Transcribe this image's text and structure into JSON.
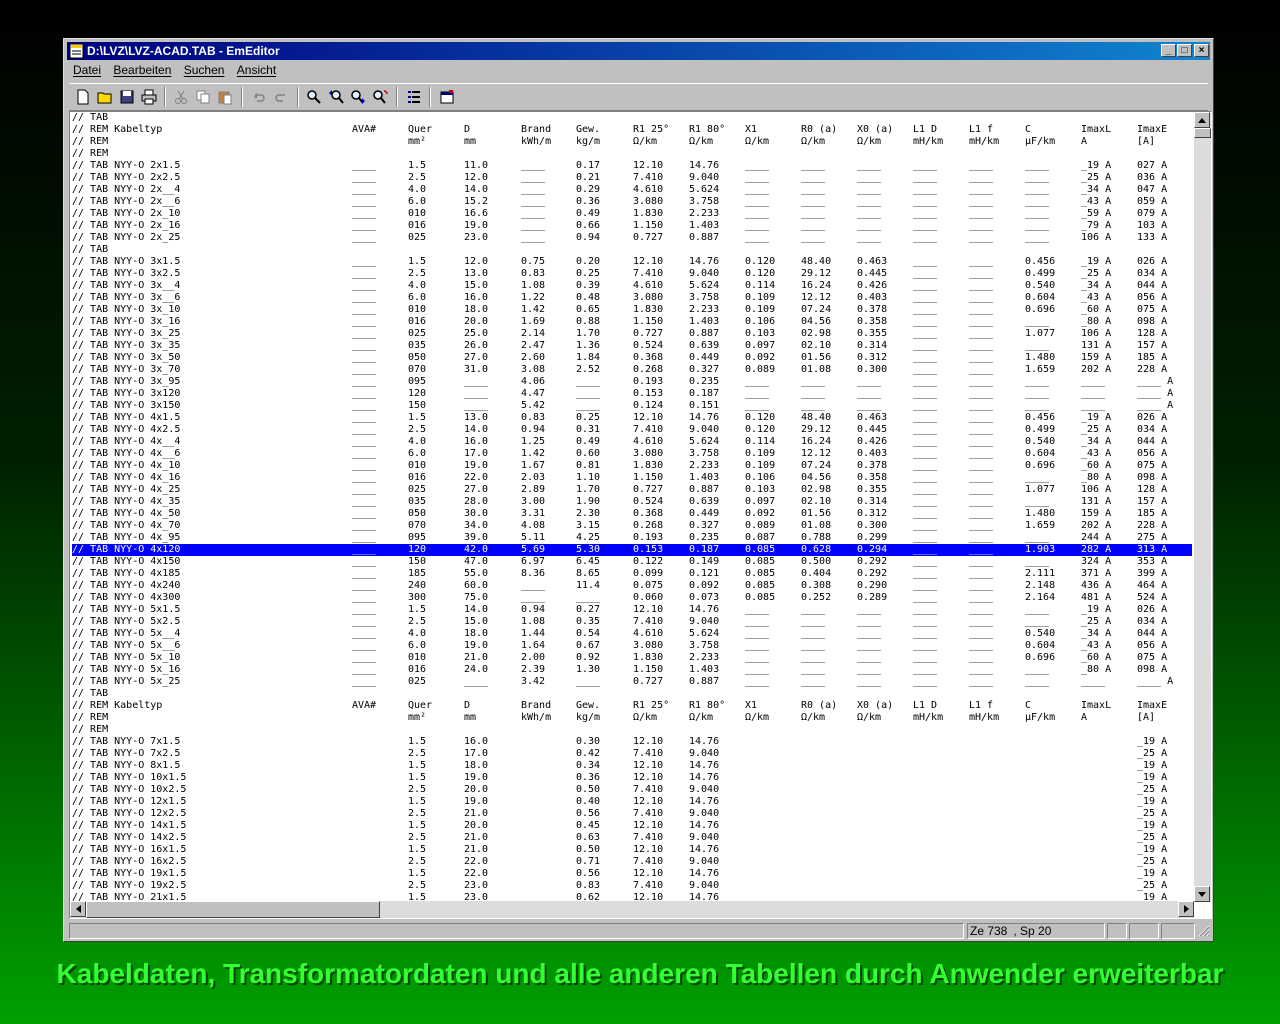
{
  "window": {
    "title": "D:\\LVZ\\LVZ-ACAD.TAB - EmEditor",
    "min_label": "_",
    "max_label": "□",
    "close_label": "×"
  },
  "menu": [
    {
      "label": "Datei"
    },
    {
      "label": "Bearbeiten"
    },
    {
      "label": "Suchen"
    },
    {
      "label": "Ansicht"
    }
  ],
  "toolbar": [
    {
      "name": "new-file-icon"
    },
    {
      "name": "open-folder-icon"
    },
    {
      "name": "save-icon"
    },
    {
      "name": "print-icon"
    },
    {
      "name": "cut-icon"
    },
    {
      "name": "copy-icon"
    },
    {
      "name": "paste-icon"
    },
    {
      "name": "undo-icon"
    },
    {
      "name": "redo-icon"
    },
    {
      "name": "find-icon"
    },
    {
      "name": "find-previous-icon"
    },
    {
      "name": "find-next-icon"
    },
    {
      "name": "replace-icon"
    },
    {
      "name": "properties-icon"
    },
    {
      "name": "window-icon"
    }
  ],
  "editor": {
    "lines": [
      "// TAB",
      "// REM Kabeltyp|AVA#|Quer|D|Brand|Gew.|R1 25°|R1 80°|X1|R0 (a)|X0 (a)|L1 D|L1 f|C|ImaxL|ImaxE",
      "// REM||mm²|mm|kWh/m|kg/m|Ω/km|Ω/km|Ω/km|Ω/km|Ω/km|mH/km|mH/km|µF/km|A|[A]",
      "// REM",
      "// TAB NYY-O 2x1.5|____|1.5|11.0|____|0.17|12.10|14.76|____|____|____|____|____|____|_19 A|027 A",
      "// TAB NYY-O 2x2.5|____|2.5|12.0|____|0.21|7.410|9.040|____|____|____|____|____|____|_25 A|036 A",
      "// TAB NYY-O 2x__4|____|4.0|14.0|____|0.29|4.610|5.624|____|____|____|____|____|____|_34 A|047 A",
      "// TAB NYY-O 2x__6|____|6.0|15.2|____|0.36|3.080|3.758|____|____|____|____|____|____|_43 A|059 A",
      "// TAB NYY-O 2x_10|____|010|16.6|____|0.49|1.830|2.233|____|____|____|____|____|____|_59 A|079 A",
      "// TAB NYY-O 2x_16|____|016|19.0|____|0.66|1.150|1.403|____|____|____|____|____|____|_79 A|103 A",
      "// TAB NYY-O 2x_25|____|025|23.0|____|0.94|0.727|0.887|____|____|____|____|____|____|106 A|133 A",
      "// TAB",
      "// TAB NYY-O 3x1.5|____|1.5|12.0|0.75|0.20|12.10|14.76|0.120|48.40|0.463|____|____|0.456|_19 A|026 A",
      "// TAB NYY-O 3x2.5|____|2.5|13.0|0.83|0.25|7.410|9.040|0.120|29.12|0.445|____|____|0.499|_25 A|034 A",
      "// TAB NYY-O 3x__4|____|4.0|15.0|1.08|0.39|4.610|5.624|0.114|16.24|0.426|____|____|0.540|_34 A|044 A",
      "// TAB NYY-O 3x__6|____|6.0|16.0|1.22|0.48|3.080|3.758|0.109|12.12|0.403|____|____|0.604|_43 A|056 A",
      "// TAB NYY-O 3x_10|____|010|18.0|1.42|0.65|1.830|2.233|0.109|07.24|0.378|____|____|0.696|_60 A|075 A",
      "// TAB NYY-O 3x_16|____|016|20.0|1.69|0.88|1.150|1.403|0.106|04.56|0.358|____|____|____|_80 A|098 A",
      "// TAB NYY-O 3x_25|____|025|25.0|2.14|1.70|0.727|0.887|0.103|02.98|0.355|____|____|1.077|106 A|128 A",
      "// TAB NYY-O 3x_35|____|035|26.0|2.47|1.36|0.524|0.639|0.097|02.10|0.314|____|____|____|131 A|157 A",
      "// TAB NYY-O 3x_50|____|050|27.0|2.60|1.84|0.368|0.449|0.092|01.56|0.312|____|____|1.480|159 A|185 A",
      "// TAB NYY-O 3x_70|____|070|31.0|3.08|2.52|0.268|0.327|0.089|01.08|0.300|____|____|1.659|202 A|228 A",
      "// TAB NYY-O 3x_95|____|095|____|4.06|____|0.193|0.235|____|____|____|____|____|____|____|____ A",
      "// TAB NYY-O 3x120|____|120|____|4.47|____|0.153|0.187|____|____|____|____|____|____|____|____ A",
      "// TAB NYY-O 3x150|____|150|____|5.42|____|0.124|0.151|____|____|____|____|____|____|____|____ A",
      "// TAB NYY-O 4x1.5|____|1.5|13.0|0.83|0.25|12.10|14.76|0.120|48.40|0.463|____|____|0.456|_19 A|026 A",
      "// TAB NYY-O 4x2.5|____|2.5|14.0|0.94|0.31|7.410|9.040|0.120|29.12|0.445|____|____|0.499|_25 A|034 A",
      "// TAB NYY-O 4x__4|____|4.0|16.0|1.25|0.49|4.610|5.624|0.114|16.24|0.426|____|____|0.540|_34 A|044 A",
      "// TAB NYY-O 4x__6|____|6.0|17.0|1.42|0.60|3.080|3.758|0.109|12.12|0.403|____|____|0.604|_43 A|056 A",
      "// TAB NYY-O 4x_10|____|010|19.0|1.67|0.81|1.830|2.233|0.109|07.24|0.378|____|____|0.696|_60 A|075 A",
      "// TAB NYY-O 4x_16|____|016|22.0|2.03|1.10|1.150|1.403|0.106|04.56|0.358|____|____|____|_80 A|098 A",
      "// TAB NYY-O 4x_25|____|025|27.0|2.89|1.70|0.727|0.887|0.103|02.98|0.355|____|____|1.077|106 A|128 A",
      "// TAB NYY-O 4x_35|____|035|28.0|3.00|1.90|0.524|0.639|0.097|02.10|0.314|____|____|____|131 A|157 A",
      "// TAB NYY-O 4x_50|____|050|30.0|3.31|2.30|0.368|0.449|0.092|01.56|0.312|____|____|1.480|159 A|185 A",
      "// TAB NYY-O 4x_70|____|070|34.0|4.08|3.15|0.268|0.327|0.089|01.08|0.300|____|____|1.659|202 A|228 A",
      "// TAB NYY-O 4x_95|____|095|39.0|5.11|4.25|0.193|0.235|0.087|0.788|0.299|____|____|____|244 A|275 A",
      "// TAB NYY-O 4x120|____|120|42.0|5.69|5.30|0.153|0.187|0.085|0.628|0.294|____|____|1.903|282 A|313 A",
      "// TAB NYY-O 4x150|____|150|47.0|6.97|6.45|0.122|0.149|0.085|0.500|0.292|____|____|____|324 A|353 A",
      "// TAB NYY-O 4x185|____|185|55.0|8.36|8.65|0.099|0.121|0.085|0.404|0.292|____|____|2.111|371 A|399 A",
      "// TAB NYY-O 4x240|____|240|60.0|____|11.4|0.075|0.092|0.085|0.308|0.290|____|____|2.148|436 A|464 A",
      "// TAB NYY-O 4x300|____|300|75.0|____|____|0.060|0.073|0.085|0.252|0.289|____|____|2.164|481 A|524 A",
      "// TAB NYY-O 5x1.5|____|1.5|14.0|0.94|0.27|12.10|14.76|____|____|____|____|____|____|_19 A|026 A",
      "// TAB NYY-O 5x2.5|____|2.5|15.0|1.08|0.35|7.410|9.040|____|____|____|____|____|____|_25 A|034 A",
      "// TAB NYY-O 5x__4|____|4.0|18.0|1.44|0.54|4.610|5.624|____|____|____|____|____|0.540|_34 A|044 A",
      "// TAB NYY-O 5x__6|____|6.0|19.0|1.64|0.67|3.080|3.758|____|____|____|____|____|0.604|_43 A|056 A",
      "// TAB NYY-O 5x_10|____|010|21.0|2.00|0.92|1.830|2.233|____|____|____|____|____|0.696|_60 A|075 A",
      "// TAB NYY-O 5x_16|____|016|24.0|2.39|1.30|1.150|1.403|____|____|____|____|____|____|_80 A|098 A",
      "// TAB NYY-O 5x_25|____|025|____|3.42|____|0.727|0.887|____|____|____|____|____|____|____|____ A",
      "// TAB",
      "// REM Kabeltyp|AVA#|Quer|D|Brand|Gew.|R1 25°|R1 80°|X1|R0 (a)|X0 (a)|L1 D|L1 f|C|ImaxL|ImaxE",
      "// REM||mm²|mm|kWh/m|kg/m|Ω/km|Ω/km|Ω/km|Ω/km|Ω/km|mH/km|mH/km|µF/km|A|[A]",
      "// REM",
      "// TAB NYY-O 7x1.5||1.5|16.0||0.30|12.10|14.76||||||||_19 A|027 A",
      "// TAB NYY-O 7x2.5||2.5|17.0||0.42|7.410|9.040||||||||_25 A|036 A",
      "// TAB NYY-O 8x1.5||1.5|18.0||0.34|12.10|14.76||||||||_19 A|027 A",
      "// TAB NYY-O 10x1.5||1.5|19.0||0.36|12.10|14.76||||||||_19 A|027 A",
      "// TAB NYY-O 10x2.5||2.5|20.0||0.50|7.410|9.040||||||||_25 A|036 A",
      "// TAB NYY-O 12x1.5||1.5|19.0||0.40|12.10|14.76||||||||_19 A|027 A",
      "// TAB NYY-O 12x2.5||2.5|21.0||0.56|7.410|9.040||||||||_25 A|036 A",
      "// TAB NYY-O 14x1.5||1.5|20.0||0.45|12.10|14.76||||||||_19 A|027 A",
      "// TAB NYY-O 14x2.5||2.5|21.0||0.63|7.410|9.040||||||||_25 A|036 A",
      "// TAB NYY-O 16x1.5||1.5|21.0||0.50|12.10|14.76||||||||_19 A|027 A",
      "// TAB NYY-O 16x2.5||2.5|22.0||0.71|7.410|9.040||||||||_25 A|036 A",
      "// TAB NYY-O 19x1.5||1.5|22.0||0.56|12.10|14.76||||||||_19 A|027 A",
      "// TAB NYY-O 19x2.5||2.5|23.0||0.83|7.410|9.040||||||||_25 A|036 A",
      "// TAB NYY-O 21x1.5||1.5|23.0||0.62|12.10|14.76||||||||_19 A|027 A"
    ],
    "selected_line": 36
  },
  "status": {
    "line": "Ze 738",
    "col": ", Sp 20"
  },
  "caption": "Kabeldaten, Transformatordaten und alle anderen Tabellen durch Anwender erweiterbar",
  "colors": {
    "selection": "#0000ff",
    "caption": "#33ff33",
    "titlebar": "#000080"
  }
}
